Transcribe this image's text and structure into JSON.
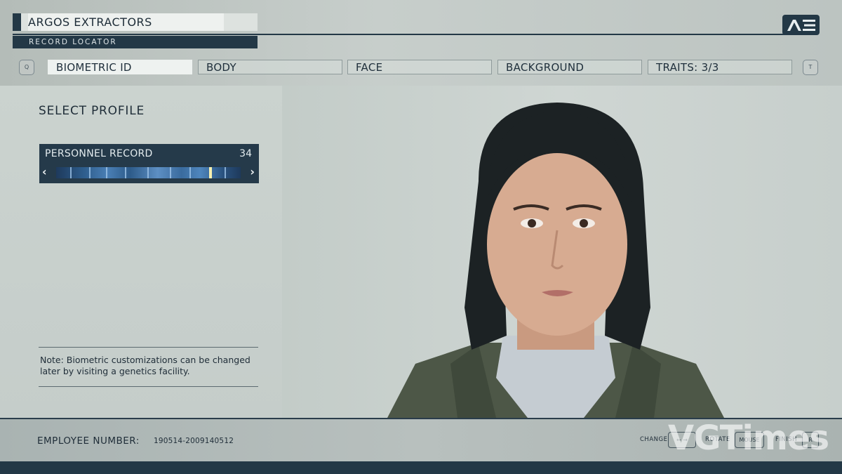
{
  "header": {
    "org_name": "ARGOS EXTRACTORS",
    "subtitle": "RECORD LOCATOR",
    "logo_text": "AE"
  },
  "tabs": {
    "left_key": "Q",
    "right_key": "T",
    "items": [
      {
        "label": "BIOMETRIC ID",
        "active": true
      },
      {
        "label": "BODY",
        "active": false
      },
      {
        "label": "FACE",
        "active": false
      },
      {
        "label": "BACKGROUND",
        "active": false
      },
      {
        "label": "TRAITS: 3/3",
        "active": false
      }
    ]
  },
  "profile": {
    "title": "SELECT PROFILE",
    "record_label": "PERSONNEL RECORD",
    "record_number": "34",
    "prev_glyph": "‹",
    "next_glyph": "›"
  },
  "note": "Note: Biometric customizations can be changed later by visiting a genetics facility.",
  "footer": {
    "employee_label": "EMPLOYEE NUMBER:",
    "employee_number": "190514-2009140512",
    "controls": [
      {
        "label": "CHANGE",
        "key": "← →"
      },
      {
        "label": "ROTATE",
        "key": "MOUSE"
      },
      {
        "label": "FINISH",
        "key": "R"
      }
    ]
  },
  "watermark": "VGTimes",
  "colors": {
    "navy": "#233846",
    "panel": "#c9d1cc",
    "active_tab": "#eef2f0",
    "barcode_highlight": "#f7f0b0"
  },
  "icons": {
    "logo": "ae-logo-icon",
    "prev": "chevron-left-icon",
    "next": "chevron-right-icon"
  }
}
